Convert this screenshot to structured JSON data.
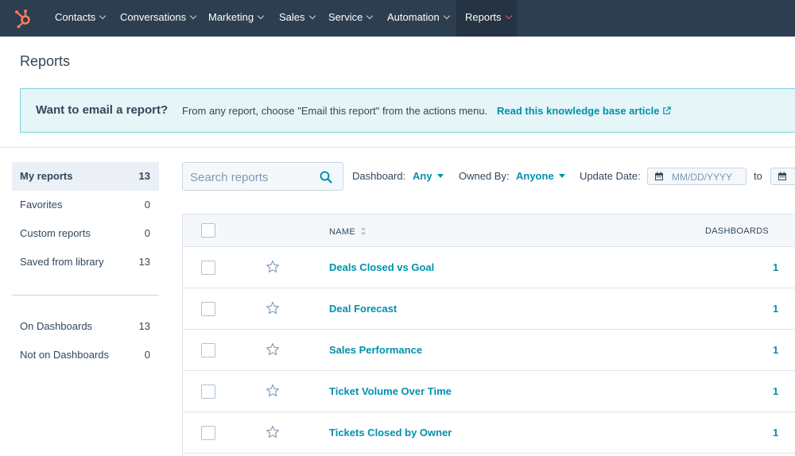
{
  "nav": {
    "items": [
      {
        "label": "Contacts"
      },
      {
        "label": "Conversations"
      },
      {
        "label": "Marketing"
      },
      {
        "label": "Sales"
      },
      {
        "label": "Service"
      },
      {
        "label": "Automation"
      },
      {
        "label": "Reports"
      }
    ],
    "active": "Reports",
    "logo_icon": "hubspot-sprocket-icon",
    "colors": {
      "bar": "#2d3e50",
      "accent": "#ff7a59",
      "active_chevron": "#f2547d"
    }
  },
  "page": {
    "title": "Reports"
  },
  "banner": {
    "title": "Want to email a report?",
    "text": "From any report, choose \"Email this report\" from the actions menu.",
    "link": "Read this knowledge base article",
    "link_icon": "external-link-icon"
  },
  "sidebar": {
    "items": [
      {
        "label": "My reports",
        "count": "13"
      },
      {
        "label": "Favorites",
        "count": "0"
      },
      {
        "label": "Custom reports",
        "count": "0"
      },
      {
        "label": "Saved from library",
        "count": "13"
      },
      {
        "label": "On Dashboards",
        "count": "13"
      },
      {
        "label": "Not on Dashboards",
        "count": "0"
      }
    ],
    "selected": "My reports"
  },
  "filters": {
    "search_placeholder": "Search reports",
    "dashboard_label": "Dashboard:",
    "dashboard_value": "Any",
    "owned_label": "Owned By:",
    "owned_value": "Anyone",
    "update_label": "Update Date:",
    "date_placeholder": "MM/DD/YYYY",
    "to_label": "to"
  },
  "table": {
    "columns": {
      "name": "NAME",
      "dashboards": "DASHBOARDS"
    },
    "rows": [
      {
        "name": "Deals Closed vs Goal",
        "dashboards": "1"
      },
      {
        "name": "Deal Forecast",
        "dashboards": "1"
      },
      {
        "name": "Sales Performance",
        "dashboards": "1"
      },
      {
        "name": "Ticket Volume Over Time",
        "dashboards": "1"
      },
      {
        "name": "Tickets Closed by Owner",
        "dashboards": "1"
      }
    ]
  },
  "colors": {
    "link": "#0091ae",
    "text": "#33475b",
    "banner_bg": "#e5f5f8",
    "banner_border": "#7fd1de"
  }
}
